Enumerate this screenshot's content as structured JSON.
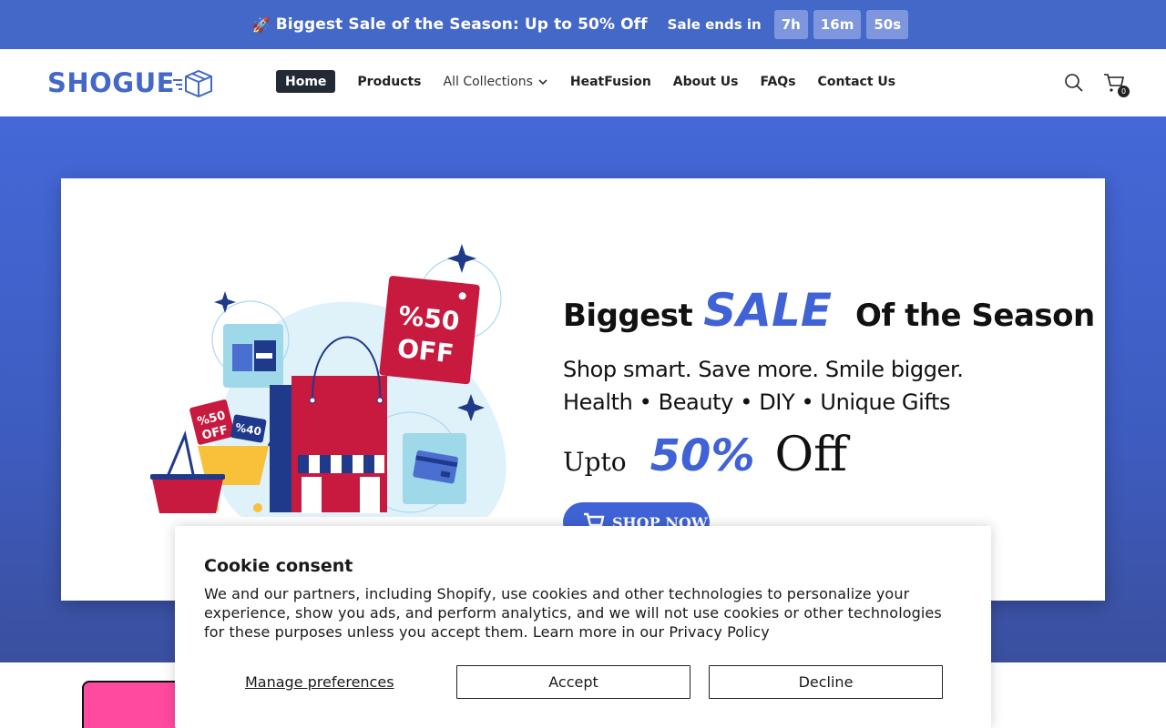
{
  "announcement": {
    "text": "Biggest Sale of the Season: Up to 50% Off",
    "rocket_icon": "rocket-icon",
    "sale_ends_label": "Sale ends in",
    "timer": {
      "hours": "7h",
      "minutes": "16m",
      "seconds": "50s"
    }
  },
  "header": {
    "logo_text": "SHOGUE",
    "nav": [
      {
        "label": "Home",
        "active": true
      },
      {
        "label": "Products"
      },
      {
        "label": "All Collections",
        "has_dropdown": true
      },
      {
        "label": "HeatFusion"
      },
      {
        "label": "About Us"
      },
      {
        "label": "FAQs"
      },
      {
        "label": "Contact Us"
      }
    ],
    "cart_count": "0",
    "icons": [
      "search-icon",
      "cart-icon"
    ]
  },
  "hero": {
    "title_part1": "Biggest",
    "title_highlight": "SALE",
    "title_part2": "Of the Season",
    "subtitle_line1": "Shop smart. Save more. Smile bigger.",
    "subtitle_line2": "Health • Beauty • DIY • Unique Gifts",
    "upto_label": "Upto",
    "discount": "50%",
    "off_label": "Off",
    "shop_button": "SHOP NOW",
    "illustration_tags": {
      "big_tag_line1": "%50",
      "big_tag_line2": "OFF",
      "small_tag1": "%50",
      "small_tag1_line2": "OFF",
      "small_tag2": "%40"
    },
    "accent_color": "#3f63d6",
    "background_color": "#4468c8"
  },
  "cookie": {
    "title": "Cookie consent",
    "body": "We and our partners, including Shopify, use cookies and other technologies to personalize your experience, show you ads, and perform analytics, and we will not use cookies or other technologies for these purposes unless you accept them. Learn more in our Privacy Policy",
    "manage_label": "Manage preferences",
    "accept_label": "Accept",
    "decline_label": "Decline"
  }
}
